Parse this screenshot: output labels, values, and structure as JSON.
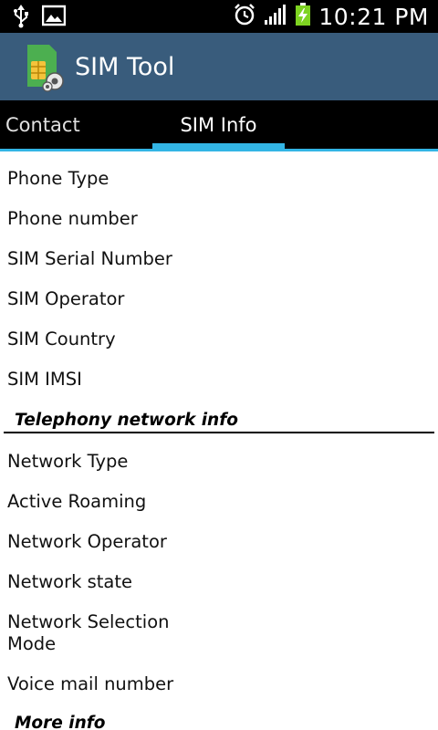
{
  "status_bar": {
    "clock": "10:21 PM",
    "icons": [
      "usb-icon",
      "image-icon",
      "alarm-icon",
      "signal-icon",
      "battery-charging-icon"
    ]
  },
  "app_bar": {
    "title": "SIM Tool",
    "icon": "sim-card-gear-icon"
  },
  "tabs": [
    {
      "label": "Contact",
      "selected": false
    },
    {
      "label": "SIM Info",
      "selected": true
    }
  ],
  "sim_info": {
    "rows": [
      {
        "label": "Phone Type"
      },
      {
        "label": "Phone number"
      },
      {
        "label": "SIM Serial Number"
      },
      {
        "label": "SIM Operator"
      },
      {
        "label": "SIM Country"
      },
      {
        "label": "SIM IMSI"
      }
    ]
  },
  "telephony": {
    "header": "Telephony network info",
    "rows": [
      {
        "label": "Network Type"
      },
      {
        "label": "Active Roaming"
      },
      {
        "label": "Network Operator"
      },
      {
        "label": "Network state"
      },
      {
        "label": "Network Selection",
        "label2": "Mode"
      },
      {
        "label": "Voice mail number"
      }
    ]
  },
  "more": {
    "header": "More info"
  },
  "colors": {
    "app_bar": "#395c7c",
    "tab_accent": "#33b5e5",
    "battery": "#7ed321"
  }
}
